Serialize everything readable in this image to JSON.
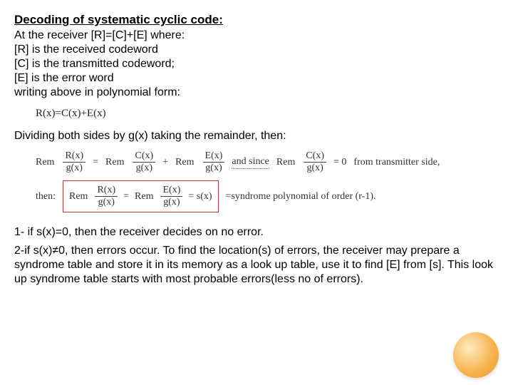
{
  "heading": "Decoding of systematic cyclic code:",
  "intro": {
    "l1": "At the receiver [R]=[C]+[E] where:",
    "l2": "[R] is the received codeword",
    "l3": "[C] is the transmitted codeword;",
    "l4": "[E] is the error word",
    "l5": "writing above in polynomial form:"
  },
  "eq1": "R(x)=C(x)+E(x)",
  "divtext": "Dividing both sides by g(x) taking the remainder, then:",
  "eq2": {
    "rem": "Rem",
    "rx": "R(x)",
    "cx": "C(x)",
    "ex": "E(x)",
    "gx": "g(x)",
    "eq": "=",
    "plus": "+",
    "and_since": "and since",
    "zero": "= 0",
    "from_tx": "from transmitter side,",
    "then": "then:",
    "sx": "= s(x)",
    "syn": "=syndrome polynomial of order (r-1)."
  },
  "conclusion": {
    "c1": "1- if s(x)=0, then the receiver decides on no error.",
    "c2": "2-if s(x)≠0, then errors occur. To find the location(s) of errors, the receiver may prepare a syndrome table and store it in its memory as a look up table, use it to find [E] from [s]. This look up syndrome table starts with most probable errors(less no of errors)."
  }
}
